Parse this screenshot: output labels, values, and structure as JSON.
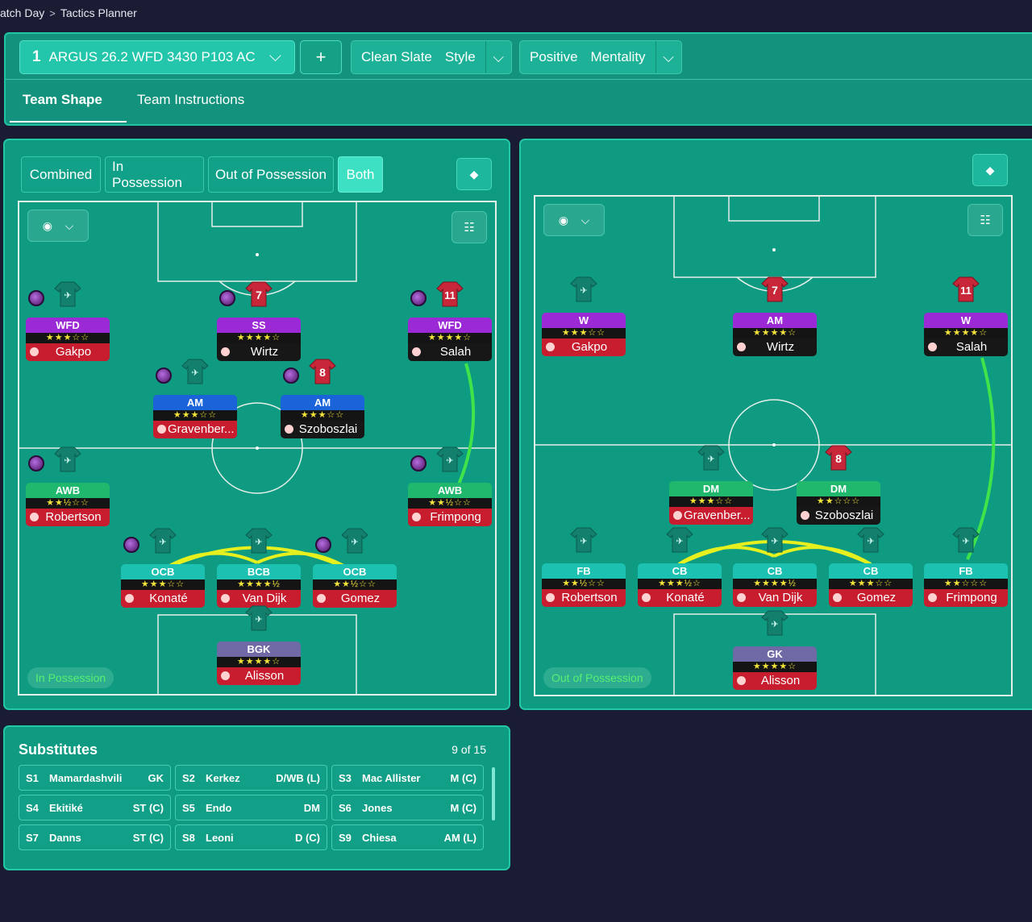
{
  "breadcrumb": {
    "parent": "atch Day",
    "separator": ">",
    "current": "Tactics Planner"
  },
  "header": {
    "tactic_number": "1",
    "tactic_name": "ARGUS 26.2 WFD 3430 P103 AC",
    "add_label": "+",
    "style_value": "Clean Slate",
    "style_label": "Style",
    "mentality_value": "Positive",
    "mentality_label": "Mentality",
    "tabs": [
      {
        "label": "Team Shape"
      },
      {
        "label": "Team Instructions"
      }
    ]
  },
  "view_tabs": [
    {
      "label": "Combined"
    },
    {
      "label": "In Possession"
    },
    {
      "label": "Out of Possession"
    },
    {
      "label": "Both"
    }
  ],
  "icons": {
    "chevron": "chevron-down-icon",
    "eye": "eye-icon",
    "grid": "grid-icon",
    "diamond": "diamond-icon",
    "person": "person-icon"
  },
  "in_possession": {
    "badge": "In Possession",
    "players": [
      {
        "role": "WFD",
        "stars": "★★★☆☆",
        "name": "Gakpo",
        "shirt": ""
      },
      {
        "role": "SS",
        "stars": "★★★★☆",
        "name": "Wirtz",
        "shirt": "7"
      },
      {
        "role": "WFD",
        "stars": "★★★★☆",
        "name": "Salah",
        "shirt": "11"
      },
      {
        "role": "AM",
        "stars": "★★★☆☆",
        "name": "Gravenber...",
        "shirt": ""
      },
      {
        "role": "AM",
        "stars": "★★★☆☆",
        "name": "Szoboszlai",
        "shirt": "8"
      },
      {
        "role": "AWB",
        "stars": "★★½☆☆",
        "name": "Robertson",
        "shirt": ""
      },
      {
        "role": "AWB",
        "stars": "★★½☆☆",
        "name": "Frimpong",
        "shirt": ""
      },
      {
        "role": "OCB",
        "stars": "★★★☆☆",
        "name": "Konaté",
        "shirt": ""
      },
      {
        "role": "BCB",
        "stars": "★★★★½",
        "name": "Van Dijk",
        "shirt": ""
      },
      {
        "role": "OCB",
        "stars": "★★½☆☆",
        "name": "Gomez",
        "shirt": ""
      },
      {
        "role": "BGK",
        "stars": "★★★★☆",
        "name": "Alisson",
        "shirt": ""
      }
    ]
  },
  "out_of_possession": {
    "badge": "Out of Possession",
    "players": [
      {
        "role": "W",
        "stars": "★★★☆☆",
        "name": "Gakpo",
        "shirt": ""
      },
      {
        "role": "AM",
        "stars": "★★★★☆",
        "name": "Wirtz",
        "shirt": "7"
      },
      {
        "role": "W",
        "stars": "★★★★☆",
        "name": "Salah",
        "shirt": "11"
      },
      {
        "role": "DM",
        "stars": "★★★☆☆",
        "name": "Gravenber...",
        "shirt": ""
      },
      {
        "role": "DM",
        "stars": "★★☆☆☆",
        "name": "Szoboszlai",
        "shirt": "8"
      },
      {
        "role": "FB",
        "stars": "★★½☆☆",
        "name": "Robertson",
        "shirt": ""
      },
      {
        "role": "CB",
        "stars": "★★★½☆",
        "name": "Konaté",
        "shirt": ""
      },
      {
        "role": "CB",
        "stars": "★★★★½",
        "name": "Van Dijk",
        "shirt": ""
      },
      {
        "role": "CB",
        "stars": "★★★☆☆",
        "name": "Gomez",
        "shirt": ""
      },
      {
        "role": "FB",
        "stars": "★★☆☆☆",
        "name": "Frimpong",
        "shirt": ""
      },
      {
        "role": "GK",
        "stars": "★★★★☆",
        "name": "Alisson",
        "shirt": ""
      }
    ]
  },
  "substitutes": {
    "title": "Substitutes",
    "count": "9 of 15",
    "list": [
      {
        "slot": "S1",
        "name": "Mamardashvili",
        "pos": "GK"
      },
      {
        "slot": "S2",
        "name": "Kerkez",
        "pos": "D/WB (L)"
      },
      {
        "slot": "S3",
        "name": "Mac Allister",
        "pos": "M (C)"
      },
      {
        "slot": "S4",
        "name": "Ekitiké",
        "pos": "ST (C)"
      },
      {
        "slot": "S5",
        "name": "Endo",
        "pos": "DM"
      },
      {
        "slot": "S6",
        "name": "Jones",
        "pos": "M (C)"
      },
      {
        "slot": "S7",
        "name": "Danns",
        "pos": "ST (C)"
      },
      {
        "slot": "S8",
        "name": "Leoni",
        "pos": "D (C)"
      },
      {
        "slot": "S9",
        "name": "Chiesa",
        "pos": "AM (L)"
      }
    ]
  },
  "colors": {
    "panel": "#0e9b82",
    "accent": "#3de0c2",
    "link_yellow": "#e7f01f",
    "link_green": "#41e34a",
    "shirt_red": "#c8273a"
  }
}
